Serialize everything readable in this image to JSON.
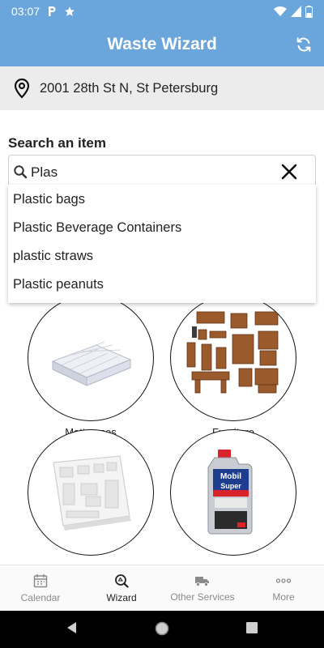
{
  "status_bar": {
    "time": "03:07",
    "icons": [
      "parking-icon",
      "star-icon",
      "wifi-icon",
      "signal-icon",
      "battery-icon"
    ]
  },
  "header": {
    "title": "Waste Wizard",
    "action_icon": "refresh-icon"
  },
  "address": {
    "icon": "location-pin-icon",
    "text": "2001 28th St N, St Petersburg"
  },
  "search": {
    "label": "Search an item",
    "value": "Plas",
    "search_icon": "search-icon",
    "clear_icon": "close-icon",
    "suggestions": [
      "Plastic bags",
      "Plastic Beverage Containers",
      "plastic straws",
      "Plastic peanuts"
    ]
  },
  "categories": [
    {
      "label": "Mattresses",
      "image": "mattress-image"
    },
    {
      "label": "Furniture",
      "image": "furniture-image"
    },
    {
      "label": "",
      "image": "styrofoam-image"
    },
    {
      "label": "",
      "image": "motor-oil-image",
      "product_text": [
        "Mobil",
        "Super"
      ]
    }
  ],
  "bottom_nav": {
    "items": [
      {
        "label": "Calendar",
        "icon": "calendar-icon",
        "active": false
      },
      {
        "label": "Wizard",
        "icon": "wizard-icon",
        "active": true
      },
      {
        "label": "Other Services",
        "icon": "truck-icon",
        "active": false
      },
      {
        "label": "More",
        "icon": "more-dots-icon",
        "active": false
      }
    ]
  },
  "system_nav": {
    "icons": [
      "back-icon",
      "home-icon",
      "recents-icon"
    ]
  },
  "colors": {
    "primary": "#6aa5dc",
    "address_background": "#ececec",
    "active_tab": "#222222",
    "inactive_tab": "#8a8a8a"
  }
}
